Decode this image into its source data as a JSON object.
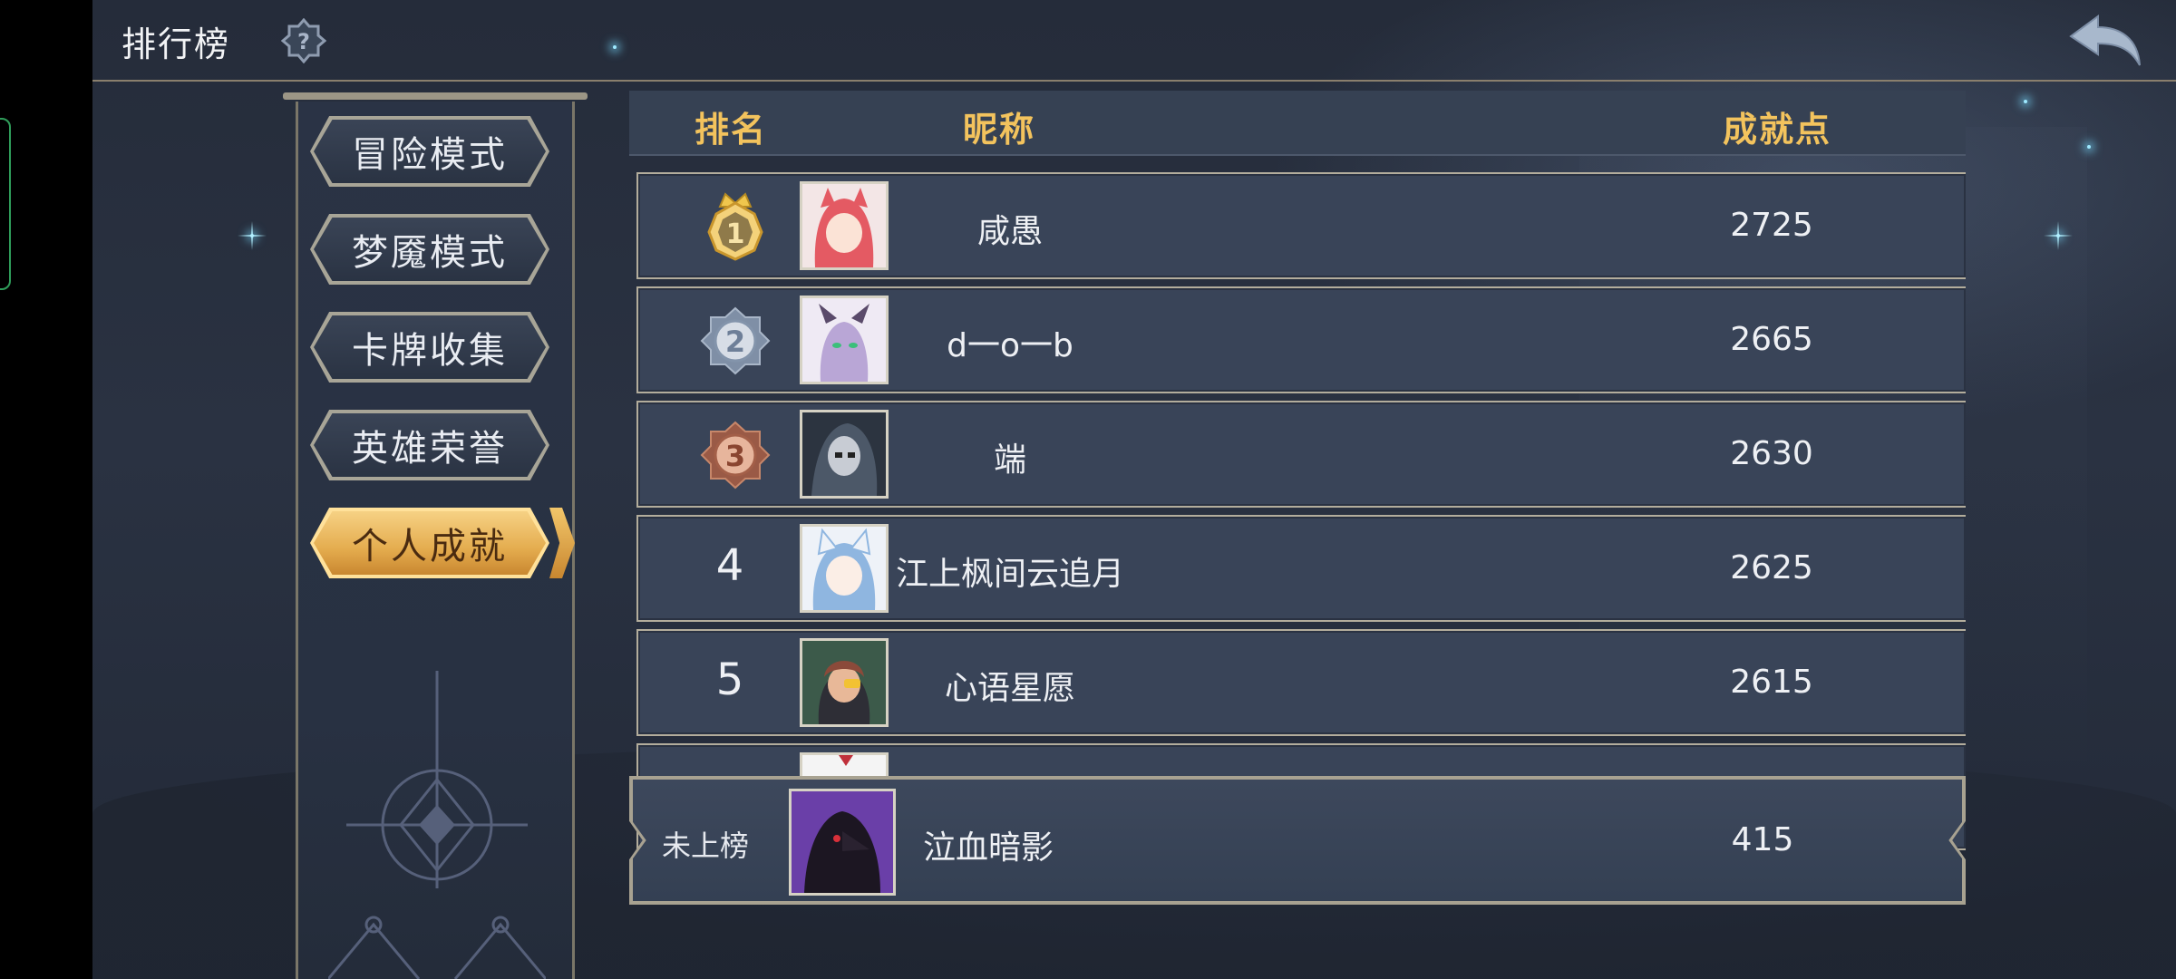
{
  "header": {
    "title": "排行榜",
    "help_icon": "help-question-icon",
    "back_icon": "back-arrow-icon"
  },
  "tabs": [
    {
      "label": "冒险模式",
      "active": false
    },
    {
      "label": "梦魇模式",
      "active": false
    },
    {
      "label": "卡牌收集",
      "active": false
    },
    {
      "label": "英雄荣誉",
      "active": false
    },
    {
      "label": "个人成就",
      "active": true
    }
  ],
  "table": {
    "columns": {
      "rank": "排名",
      "nickname": "昵称",
      "points": "成就点"
    },
    "rows": [
      {
        "rank": "1",
        "nickname": "咸愚",
        "points": "2725",
        "medal": "gold-crown",
        "avatar_color": "#e45a63"
      },
      {
        "rank": "2",
        "nickname": "d一o一b",
        "points": "2665",
        "medal": "silver",
        "avatar_color": "#b9a6d6"
      },
      {
        "rank": "3",
        "nickname": "端",
        "points": "2630",
        "medal": "bronze",
        "avatar_color": "#4c5868"
      },
      {
        "rank": "4",
        "nickname": "江上枫间云追月",
        "points": "2625",
        "medal": "",
        "avatar_color": "#8fb6e0"
      },
      {
        "rank": "5",
        "nickname": "心语星愿",
        "points": "2615",
        "medal": "",
        "avatar_color": "#8b4a3a"
      }
    ]
  },
  "self": {
    "status": "未上榜",
    "nickname": "泣血暗影",
    "points": "415",
    "avatar_color": "#6a3fa8"
  },
  "colors": {
    "header_text": "#f3c35d",
    "active_tab": "#e4ac4e",
    "background": "#2a3242"
  }
}
